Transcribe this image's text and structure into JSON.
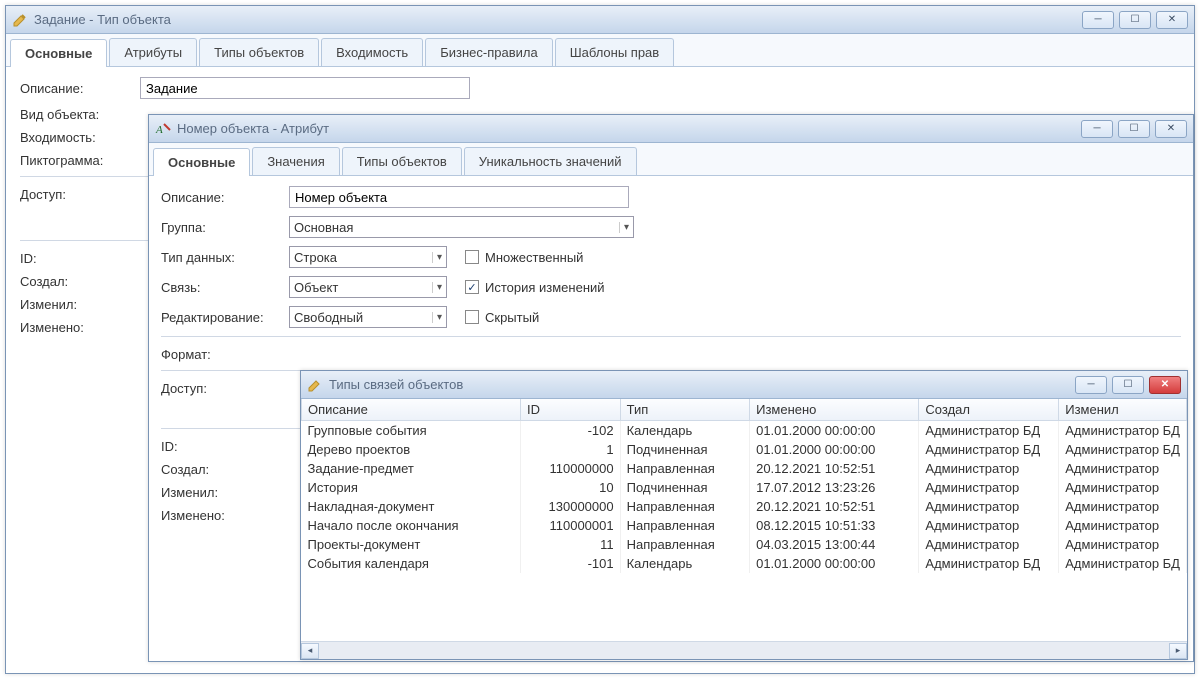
{
  "win1": {
    "title": "Задание - Тип объекта",
    "tabs": [
      "Основные",
      "Атрибуты",
      "Типы объектов",
      "Входимость",
      "Бизнес-правила",
      "Шаблоны прав"
    ],
    "active_tab": 0,
    "labels": {
      "description": "Описание:",
      "object_kind": "Вид объекта:",
      "inheritance": "Входимость:",
      "icon": "Пиктограмма:",
      "access": "Доступ:",
      "id": "ID:",
      "created": "Создал:",
      "modified_by": "Изменил:",
      "modified": "Изменено:"
    },
    "description_value": "Задание"
  },
  "win2": {
    "title": "Номер объекта - Атрибут",
    "tabs": [
      "Основные",
      "Значения",
      "Типы объектов",
      "Уникальность значений"
    ],
    "active_tab": 0,
    "labels": {
      "description": "Описание:",
      "group": "Группа:",
      "data_type": "Тип данных:",
      "link": "Связь:",
      "editing": "Редактирование:",
      "format": "Формат:",
      "access": "Доступ:",
      "id": "ID:",
      "created": "Создал:",
      "modified_by": "Изменил:",
      "modified": "Изменено:"
    },
    "values": {
      "description": "Номер объекта",
      "group": "Основная",
      "data_type": "Строка",
      "link": "Объект",
      "editing": "Свободный"
    },
    "checks": {
      "multiple": "Множественный",
      "history": "История изменений",
      "hidden": "Скрытый",
      "multiple_checked": false,
      "history_checked": true,
      "hidden_checked": false
    }
  },
  "win3": {
    "title": "Типы связей объектов",
    "columns": [
      "Описание",
      "ID",
      "Тип",
      "Изменено",
      "Создал",
      "Изменил"
    ],
    "rows": [
      {
        "desc": "Групповые события",
        "id": "-102",
        "type": "Календарь",
        "modified": "01.01.2000 00:00:00",
        "created_by": "Администратор БД",
        "modified_by": "Администратор БД"
      },
      {
        "desc": "Дерево проектов",
        "id": "1",
        "type": "Подчиненная",
        "modified": "01.01.2000 00:00:00",
        "created_by": "Администратор БД",
        "modified_by": "Администратор БД"
      },
      {
        "desc": "Задание-предмет",
        "id": "110000000",
        "type": "Направленная",
        "modified": "20.12.2021 10:52:51",
        "created_by": "Администратор",
        "modified_by": "Администратор"
      },
      {
        "desc": "История",
        "id": "10",
        "type": "Подчиненная",
        "modified": "17.07.2012 13:23:26",
        "created_by": "Администратор",
        "modified_by": "Администратор"
      },
      {
        "desc": "Накладная-документ",
        "id": "130000000",
        "type": "Направленная",
        "modified": "20.12.2021 10:52:51",
        "created_by": "Администратор",
        "modified_by": "Администратор"
      },
      {
        "desc": "Начало после окончания",
        "id": "110000001",
        "type": "Направленная",
        "modified": "08.12.2015 10:51:33",
        "created_by": "Администратор",
        "modified_by": "Администратор"
      },
      {
        "desc": "Проекты-документ",
        "id": "11",
        "type": "Направленная",
        "modified": "04.03.2015 13:00:44",
        "created_by": "Администратор",
        "modified_by": "Администратор"
      },
      {
        "desc": "События календаря",
        "id": "-101",
        "type": "Календарь",
        "modified": "01.01.2000 00:00:00",
        "created_by": "Администратор БД",
        "modified_by": "Администратор БД"
      }
    ]
  }
}
